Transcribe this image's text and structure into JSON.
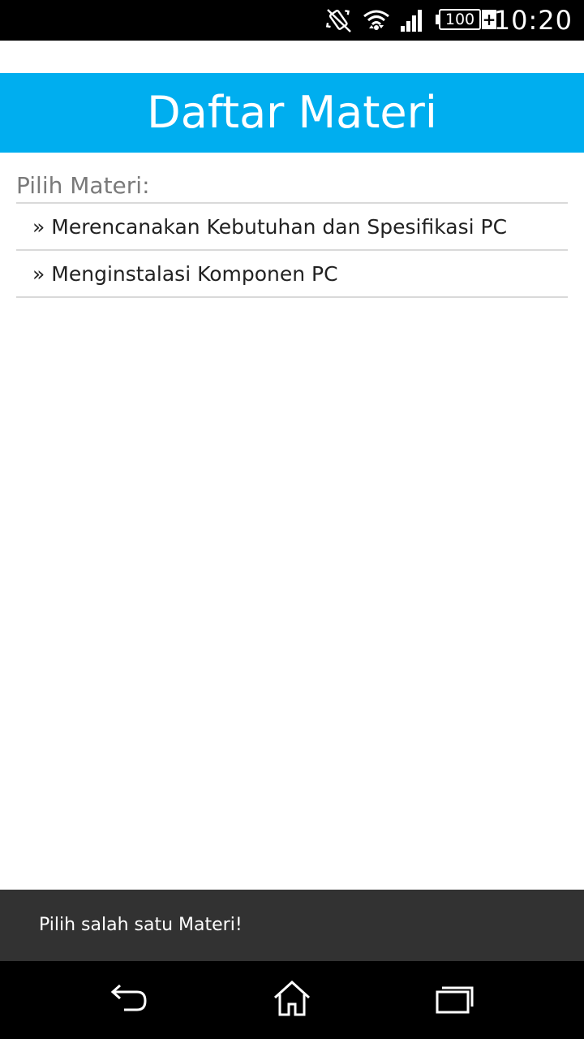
{
  "status_bar": {
    "time": "10:20",
    "battery_level": "100",
    "battery_charging_symbol": "+",
    "icons": [
      "vibrate-icon",
      "wifi-icon",
      "signal-icon",
      "battery-icon"
    ]
  },
  "header": {
    "title": "Daftar Materi"
  },
  "content": {
    "section_label": "Pilih Materi:",
    "bullet": "»",
    "items": [
      {
        "label": "Merencanakan Kebutuhan dan Spesifikasi PC"
      },
      {
        "label": "Menginstalasi Komponen PC"
      }
    ]
  },
  "toast": {
    "message": "Pilih salah satu Materi!"
  },
  "nav_bar": {
    "icons": [
      "back-icon",
      "home-icon",
      "recent-apps-icon"
    ]
  },
  "colors": {
    "header_bg": "#00aeef",
    "toast_bg": "#323232",
    "divider": "#d9d9d9",
    "label_text": "#7a7a7a"
  }
}
